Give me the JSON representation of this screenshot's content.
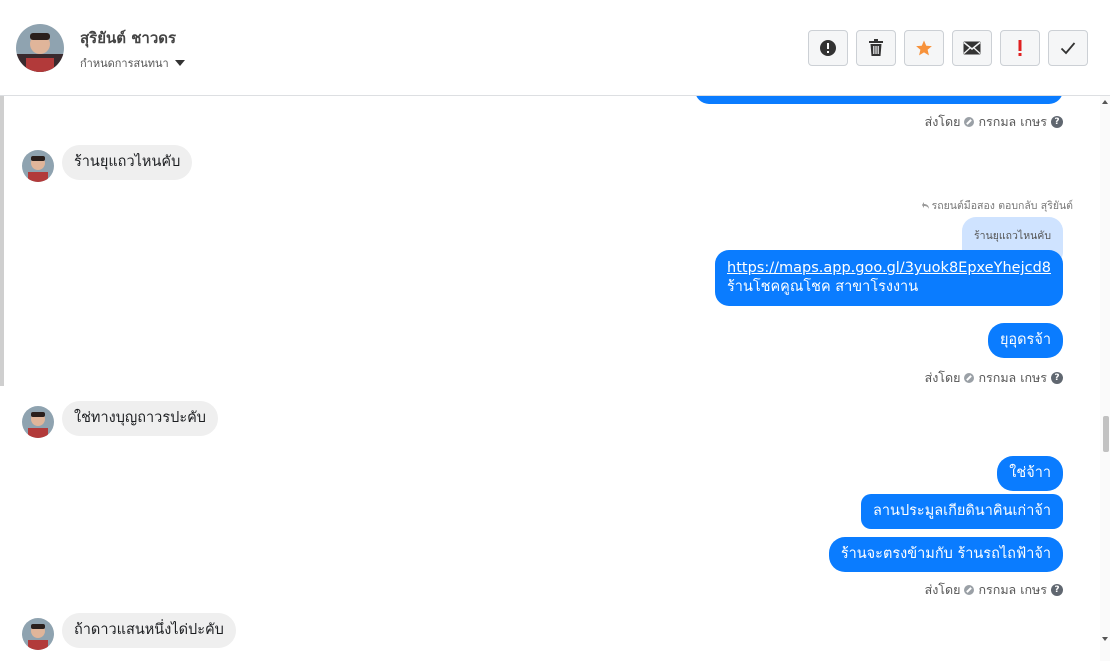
{
  "header": {
    "contact_name": "สุริยันต์ ชาวดร",
    "conversation_settings": "กำหนดการสนทนา",
    "actions": [
      "alert-circle-icon",
      "trash-icon",
      "star-icon",
      "envelope-icon",
      "exclamation-icon",
      "check-icon"
    ],
    "star_color": "#f7923b",
    "exclamation_color": "#e02020"
  },
  "thread": {
    "sent_by_label": "ส่งโดย",
    "sender_name": "กรกมล เกษร",
    "messages": {
      "in_1": "ร้านยุแถวไหนคับ",
      "reply_note": "รถยนต์มือสอง ตอบกลับ สุริยันต์",
      "quoted_text": "ร้านยุแถวไหนคับ",
      "link_text": "https://maps.app.goo.gl/3yuok8EpxeYhejcd8",
      "link_caption": "ร้านโชคคูณโชค สาขาโรงงาน",
      "out_2": "ยุอุดรจ้า",
      "in_2": "ใช่ทางบุญถาวรปะคับ",
      "out_3": "ใช่จ้าา",
      "out_4": "ลานประมูลเกียดินาคินเก่าจ้า",
      "out_5": "ร้านจะตรงข้ามกับ ร้านรถไถฟ้าจ้า",
      "in_3": "ถ้าดาวแสนหนึ่งได่ปะคับ"
    }
  },
  "colors": {
    "outgoing_bubble": "#0a7cff",
    "incoming_bubble": "#efefef",
    "quoted_bubble": "#cfe3ff"
  }
}
